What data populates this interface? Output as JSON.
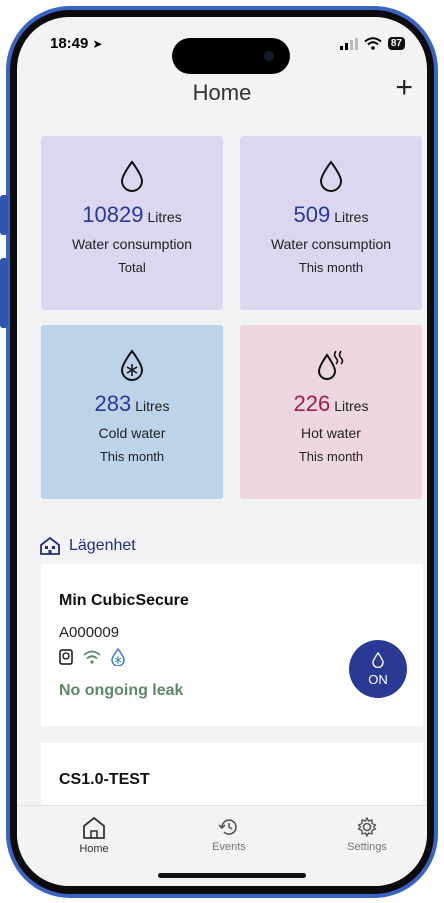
{
  "status": {
    "time": "18:49",
    "battery": "87"
  },
  "header": {
    "title": "Home",
    "add_label": "+"
  },
  "cards": [
    {
      "value": "10829",
      "unit": "Litres",
      "label": "Water consumption",
      "sub": "Total",
      "icon": "drop-icon",
      "bg": "#dcd6ee",
      "value_color": "#263a9b"
    },
    {
      "value": "509",
      "unit": "Litres",
      "label": "Water consumption",
      "sub": "This month",
      "icon": "drop-icon",
      "bg": "#dcd6ee",
      "value_color": "#263a9b"
    },
    {
      "value": "283",
      "unit": "Litres",
      "label": "Cold water",
      "sub": "This month",
      "icon": "cold-drop-icon",
      "bg": "#bcd3e9",
      "value_color": "#263a9b"
    },
    {
      "value": "226",
      "unit": "Litres",
      "label": "Hot water",
      "sub": "This month",
      "icon": "hot-water-icon",
      "bg": "#ecd6df",
      "value_color": "#a21c56"
    }
  ],
  "section": {
    "title": "Lägenhet",
    "icon": "apartment-icon"
  },
  "devices": [
    {
      "name": "Min CubicSecure",
      "id": "A000009",
      "status": "No ongoing leak",
      "toggle_label": "ON"
    },
    {
      "name": "CS1.0-TEST"
    }
  ],
  "tabs": [
    {
      "label": "Home",
      "icon": "home-icon"
    },
    {
      "label": "Events",
      "icon": "history-icon"
    },
    {
      "label": "Settings",
      "icon": "gear-icon"
    }
  ],
  "colors": {
    "accent": "#2a3a94",
    "ok_status": "#5b8a63",
    "phone_frame": "#3b63c4"
  }
}
